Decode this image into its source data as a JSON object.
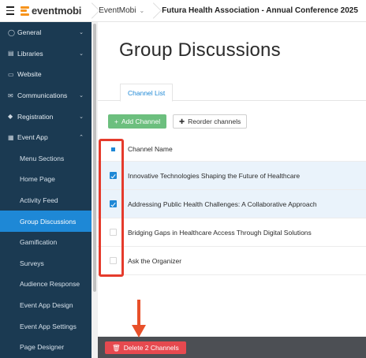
{
  "header": {
    "logo_text": "eventmobi",
    "org_crumb": "EventMobi",
    "event_crumb": "Futura Health Association - Annual Conference 2025"
  },
  "sidebar": {
    "items": [
      {
        "label": "General",
        "icon": "globe-icon",
        "chevron": "down"
      },
      {
        "label": "Libraries",
        "icon": "book-icon",
        "chevron": "down"
      },
      {
        "label": "Website",
        "icon": "monitor-icon",
        "chevron": ""
      },
      {
        "label": "Communications",
        "icon": "mail-icon",
        "chevron": "down"
      },
      {
        "label": "Registration",
        "icon": "tag-icon",
        "chevron": "down"
      },
      {
        "label": "Event App",
        "icon": "app-icon",
        "chevron": "up"
      }
    ],
    "sub_items": [
      {
        "label": "Menu Sections"
      },
      {
        "label": "Home Page"
      },
      {
        "label": "Activity Feed"
      },
      {
        "label": "Group Discussions",
        "active": true
      },
      {
        "label": "Gamification"
      },
      {
        "label": "Surveys"
      },
      {
        "label": "Audience Response"
      },
      {
        "label": "Event App Design"
      },
      {
        "label": "Event App Settings"
      },
      {
        "label": "Page Designer"
      }
    ]
  },
  "main": {
    "title": "Group Discussions",
    "tab_label": "Channel List",
    "add_label": "Add Channel",
    "reorder_label": "Reorder channels",
    "column_header": "Channel Name",
    "rows": [
      {
        "name": "Innovative Technologies Shaping the Future of Healthcare",
        "checked": true
      },
      {
        "name": "Addressing Public Health Challenges: A Collaborative Approach",
        "checked": true
      },
      {
        "name": "Bridging Gaps in Healthcare Access Through Digital Solutions",
        "checked": false
      },
      {
        "name": "Ask the Organizer",
        "checked": false
      }
    ]
  },
  "footer": {
    "delete_label": "Delete 2 Channels"
  },
  "colors": {
    "sidebar_bg": "#1b3a52",
    "active_item": "#1e88d6",
    "add_button": "#6cbf7e",
    "delete_button": "#e6494f",
    "annotation_red": "#e53b2c",
    "logo_orange": "#f7941d"
  }
}
